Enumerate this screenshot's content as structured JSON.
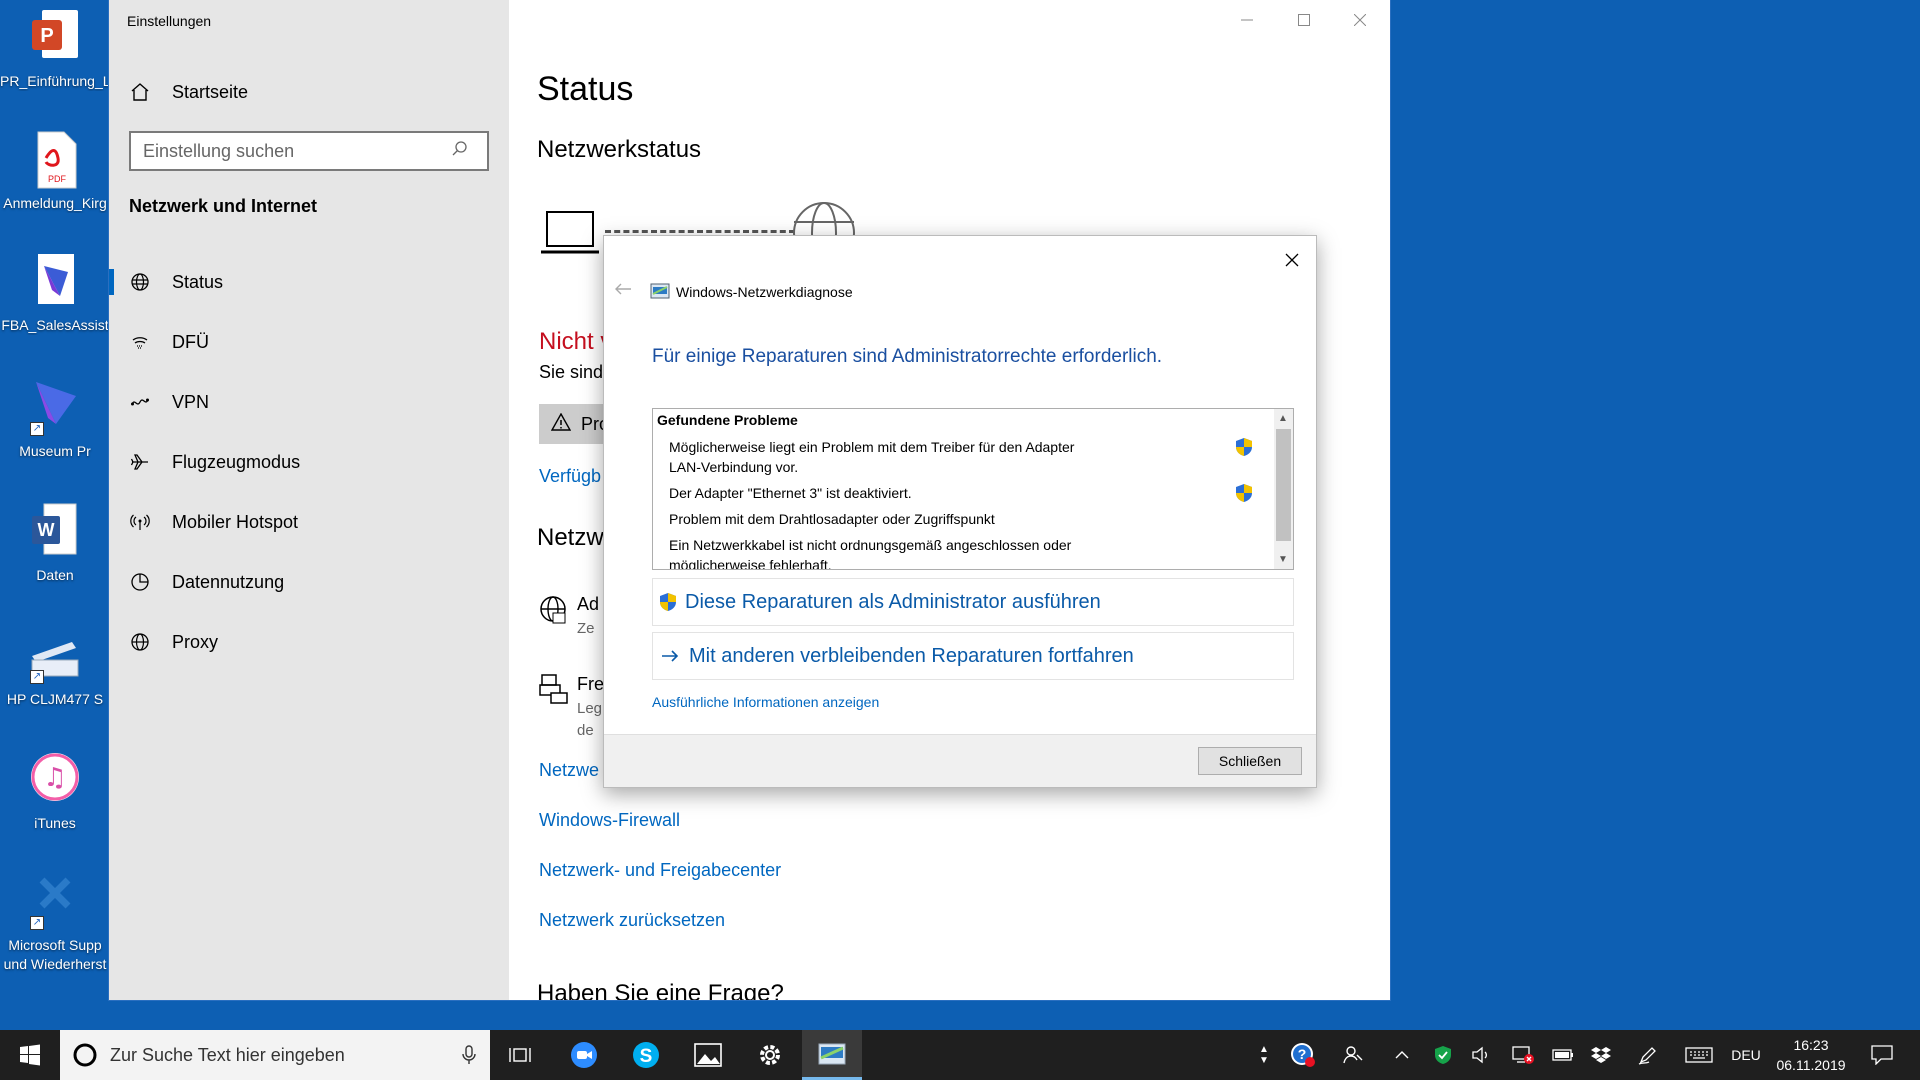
{
  "desktop": {
    "icons": [
      {
        "label": "PR_Einführung_L",
        "icon": "powerpoint-icon"
      },
      {
        "label": "Anmeldung_Kirg",
        "icon": "pdf-icon"
      },
      {
        "label": "FBA_SalesAssist",
        "icon": "app-icon"
      },
      {
        "label": "Museum Pr",
        "icon": "app-shortcut-icon"
      },
      {
        "label": "Daten",
        "icon": "word-icon"
      },
      {
        "label": "HP CLJM477 S",
        "icon": "scanner-icon"
      },
      {
        "label": "iTunes",
        "icon": "itunes-icon"
      },
      {
        "label": "Microsoft Supp und Wiederherst",
        "icon": "support-tool-icon"
      }
    ]
  },
  "settings": {
    "title": "Einstellungen",
    "home": "Startseite",
    "search_placeholder": "Einstellung suchen",
    "section": "Netzwerk und Internet",
    "nav": [
      {
        "label": "Status",
        "icon": "globe-status-icon"
      },
      {
        "label": "DFÜ",
        "icon": "dialup-icon"
      },
      {
        "label": "VPN",
        "icon": "vpn-icon"
      },
      {
        "label": "Flugzeugmodus",
        "icon": "airplane-icon"
      },
      {
        "label": "Mobiler Hotspot",
        "icon": "hotspot-icon"
      },
      {
        "label": "Datennutzung",
        "icon": "data-usage-icon"
      },
      {
        "label": "Proxy",
        "icon": "globe-icon"
      }
    ],
    "main": {
      "title": "Status",
      "subtitle": "Netzwerkstatus",
      "not_connected": "Nicht v",
      "desc": "Sie sind",
      "troubleshoot_btn": "Pro",
      "available_link": "Verfügb",
      "section2": "Netzw",
      "item1_title": "Ad",
      "item1_sub": "Ze",
      "item2_title": "Fre",
      "item2_sub1": "Leg",
      "item2_sub2": "de",
      "link_partial": "Netzwe",
      "link_firewall": "Windows-Firewall",
      "link_center": "Netzwerk- und Freigabecenter",
      "link_reset": "Netzwerk zurücksetzen",
      "question": "Haben Sie eine Frage?"
    }
  },
  "dialog": {
    "title": "Windows-Netzwerkdiagnose",
    "heading": "Für einige Reparaturen sind Administratorrechte erforderlich.",
    "problems_header": "Gefundene Probleme",
    "problems": [
      {
        "text": "Möglicherweise liegt ein Problem mit dem Treiber für den Adapter LAN-Verbindung vor.",
        "shield": true
      },
      {
        "text": "Der Adapter \"Ethernet 3\" ist deaktiviert.",
        "shield": true
      },
      {
        "text": "Problem mit dem Drahtlosadapter oder Zugriffspunkt",
        "shield": false
      },
      {
        "text": "Ein Netzwerkkabel ist nicht ordnungsgemäß angeschlossen oder möglicherweise fehlerhaft.",
        "shield": false
      }
    ],
    "cmd_admin": "Diese Reparaturen als Administrator ausführen",
    "cmd_continue": "Mit anderen verbleibenden Reparaturen fortfahren",
    "details_link": "Ausführliche Informationen anzeigen",
    "close_button": "Schließen"
  },
  "taskbar": {
    "search_placeholder": "Zur Suche Text hier eingeben",
    "language": "DEU",
    "time": "16:23",
    "date": "06.11.2019",
    "apps": [
      "task-view-icon",
      "zoom-icon",
      "skype-icon",
      "photos-icon",
      "settings-icon",
      "network-diagnostics-icon"
    ]
  },
  "colors": {
    "accent": "#0067c0",
    "desktop": "#0d5fb3",
    "error": "#c50f1f"
  }
}
